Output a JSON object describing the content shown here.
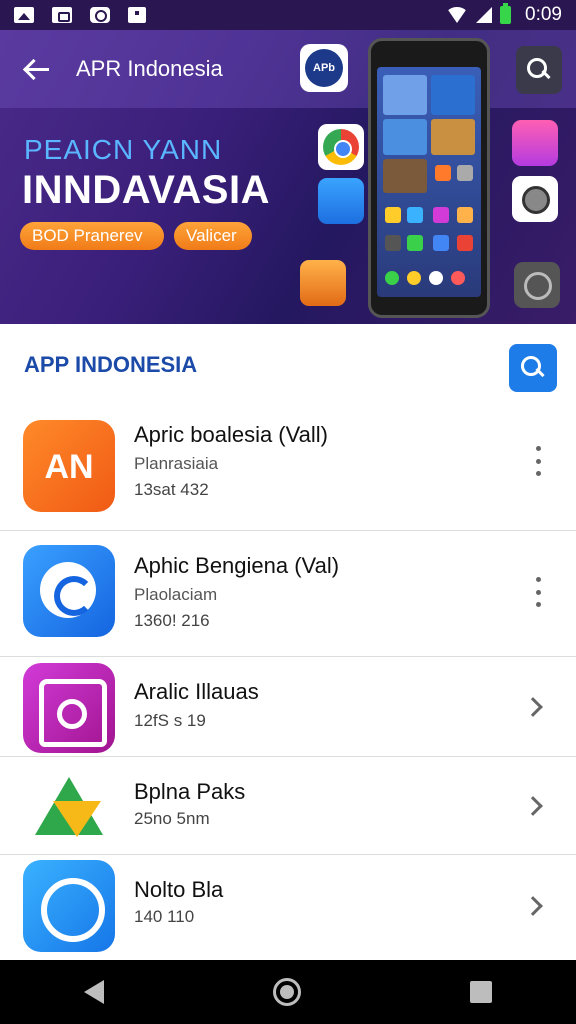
{
  "status_bar": {
    "time": "0:09",
    "icons": [
      "image-icon",
      "gamepad-icon",
      "browser-icon",
      "bag-icon",
      "wifi-icon",
      "signal-icon",
      "battery-icon"
    ]
  },
  "header": {
    "title": "APR Indonesia",
    "logo_text": "APb"
  },
  "banner": {
    "line1": "PEAICN YANN",
    "line2": "INNDAVASIA",
    "pill1": "BOD Pranerev",
    "pill2": "Valicer"
  },
  "section": {
    "title": "APP INDONESIA"
  },
  "apps": [
    {
      "name": "Apric boalesia (Vall)",
      "sub": "Planrasiaia",
      "meta": "13sat 432",
      "icon": "orange-an-icon",
      "action": "more"
    },
    {
      "name": "Aphic Bengiena (Val)",
      "sub": "Plaolaciam",
      "meta": "1360! 216",
      "icon": "blue-chat-icon",
      "action": "more"
    },
    {
      "name": "Aralic Illauas",
      "sub": "",
      "meta": "12fS s 19",
      "icon": "purple-house-icon",
      "action": "chevron"
    },
    {
      "name": "Bplna Paks",
      "sub": "",
      "meta": "25no 5nm",
      "icon": "triangle-icon",
      "action": "chevron"
    },
    {
      "name": "Nolto Bla",
      "sub": "",
      "meta": "140 110",
      "icon": "blue-refresh-icon",
      "action": "chevron"
    }
  ],
  "colors": {
    "accent": "#1e7ce8",
    "section_title": "#1b4aa8",
    "banner_bg": "#3a1f7a",
    "pill": "#f07b18"
  }
}
